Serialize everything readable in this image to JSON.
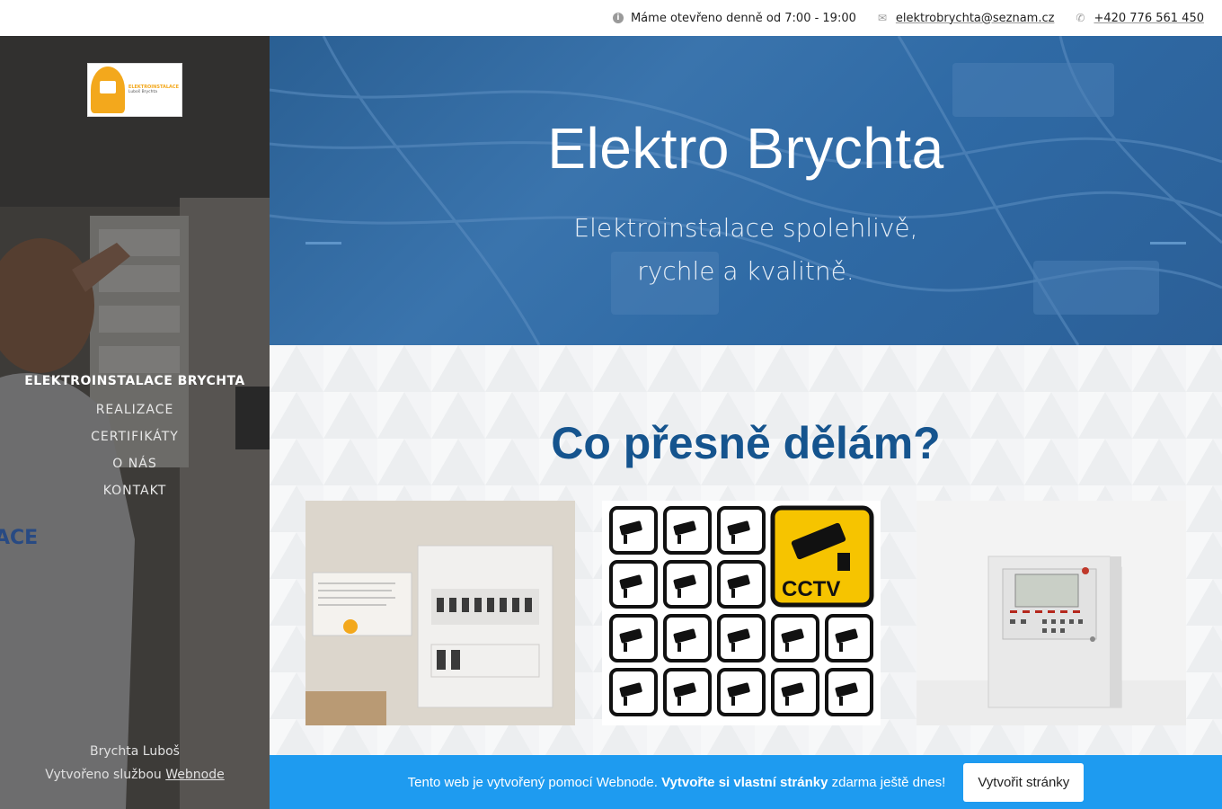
{
  "topbar": {
    "hours": "Máme otevřeno denně od 7:00 - 19:00",
    "email": "elektrobrychta@seznam.cz",
    "phone": "+420 776 561 450"
  },
  "sidebar": {
    "logo": {
      "line1": "ELEKTROINSTALACE",
      "line2": "Luboš Brychta"
    },
    "brand": "ELEKTROINSTALACE BRYCHTA",
    "nav": [
      {
        "label": "REALIZACE"
      },
      {
        "label": "CERTIFIKÁTY"
      },
      {
        "label": "O NÁS"
      },
      {
        "label": "KONTAKT"
      }
    ],
    "footer_name": "Brychta Luboš",
    "footer_created": "Vytvořeno službou",
    "footer_link": "Webnode"
  },
  "hero": {
    "title": "Elektro Brychta",
    "subtitle_line1": "Elektroinstalace spolehlivě,",
    "subtitle_line2": "rychle a kvalitně."
  },
  "section": {
    "heading": "Co přesně dělám?",
    "cctv_label": "CCTV"
  },
  "banner": {
    "text": "Tento web je vytvořený pomocí Webnode.",
    "bold": "Vytvořte si vlastní stránky",
    "tail": "zdarma ještě dnes!",
    "button": "Vytvořit stránky"
  },
  "colors": {
    "hero_blue": "#2f6aa5",
    "heading_blue": "#15548e",
    "banner_blue": "#1e9bf0",
    "cctv_yellow": "#f6c400"
  }
}
